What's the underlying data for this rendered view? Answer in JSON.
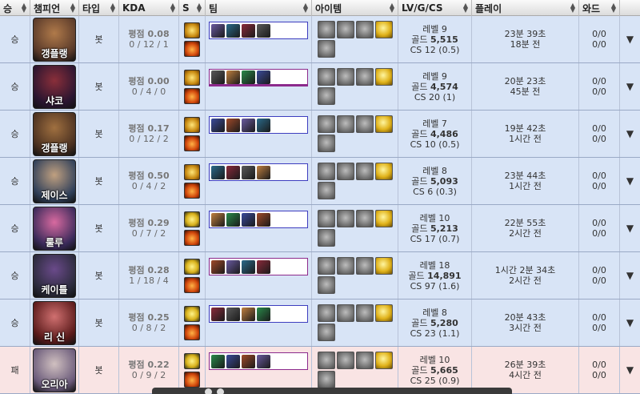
{
  "headers": {
    "result": "승",
    "champion": "챔피언",
    "type": "타입",
    "kda": "KDA",
    "spell": "S",
    "team": "팀",
    "items": "아이템",
    "lvgcs": "LV/G/CS",
    "play": "플레이",
    "ward": "와드"
  },
  "rows": [
    {
      "result": "승",
      "champion": "갱플랭",
      "type": "봇",
      "kda_avg": "평점 0.08",
      "kda": "0 / 12 / 1",
      "level": "레벨 9",
      "gold_label": "골드",
      "gold": "5,515",
      "cs": "CS 12 (0.5)",
      "duration": "23분 39초",
      "ago": "18분 전",
      "ward_a": "0/0",
      "ward_b": "0/0",
      "team_color": "blue"
    },
    {
      "result": "승",
      "champion": "샤코",
      "type": "봇",
      "kda_avg": "평점 0.00",
      "kda": "0 / 4 / 0",
      "level": "레벨 9",
      "gold_label": "골드",
      "gold": "4,574",
      "cs": "CS 20 (1)",
      "duration": "20분 23초",
      "ago": "45분 전",
      "ward_a": "0/0",
      "ward_b": "0/0",
      "team_color": "purple"
    },
    {
      "result": "승",
      "champion": "갱플랭",
      "type": "봇",
      "kda_avg": "평점 0.17",
      "kda": "0 / 12 / 2",
      "level": "레벨 7",
      "gold_label": "골드",
      "gold": "4,486",
      "cs": "CS 10 (0.5)",
      "duration": "19분 42초",
      "ago": "1시간 전",
      "ward_a": "0/0",
      "ward_b": "0/0",
      "team_color": "blue"
    },
    {
      "result": "승",
      "champion": "제이스",
      "type": "봇",
      "kda_avg": "평점 0.50",
      "kda": "0 / 4 / 2",
      "level": "레벨 8",
      "gold_label": "골드",
      "gold": "5,093",
      "cs": "CS 6 (0.3)",
      "duration": "23분 44초",
      "ago": "1시간 전",
      "ward_a": "0/0",
      "ward_b": "0/0",
      "team_color": "blue"
    },
    {
      "result": "승",
      "champion": "룰루",
      "type": "봇",
      "kda_avg": "평점 0.29",
      "kda": "0 / 7 / 2",
      "level": "레벨 10",
      "gold_label": "골드",
      "gold": "5,213",
      "cs": "CS 17 (0.7)",
      "duration": "22분 55초",
      "ago": "2시간 전",
      "ward_a": "0/0",
      "ward_b": "0/0",
      "team_color": "blue"
    },
    {
      "result": "승",
      "champion": "케이틀",
      "type": "봇",
      "kda_avg": "평점 0.28",
      "kda": "1 / 18 / 4",
      "level": "레벨 18",
      "gold_label": "골드",
      "gold": "14,891",
      "cs": "CS 97 (1.6)",
      "duration": "1시간 2분 34초",
      "ago": "2시간 전",
      "ward_a": "0/0",
      "ward_b": "0/0",
      "team_color": "purple"
    },
    {
      "result": "승",
      "champion": "리 신",
      "type": "봇",
      "kda_avg": "평점 0.25",
      "kda": "0 / 8 / 2",
      "level": "레벨 8",
      "gold_label": "골드",
      "gold": "5,280",
      "cs": "CS 23 (1.1)",
      "duration": "20분 43초",
      "ago": "3시간 전",
      "ward_a": "0/0",
      "ward_b": "0/0",
      "team_color": "blue"
    },
    {
      "result": "패",
      "champion": "오리아",
      "type": "봇",
      "kda_avg": "평점 0.22",
      "kda": "0 / 9 / 2",
      "level": "레벨 10",
      "gold_label": "골드",
      "gold": "5,665",
      "cs": "CS 25 (0.9)",
      "duration": "26분 39초",
      "ago": "4시간 전",
      "ward_a": "0/0",
      "ward_b": "0/0",
      "team_color": "purple"
    }
  ],
  "expand_icon": "▼"
}
